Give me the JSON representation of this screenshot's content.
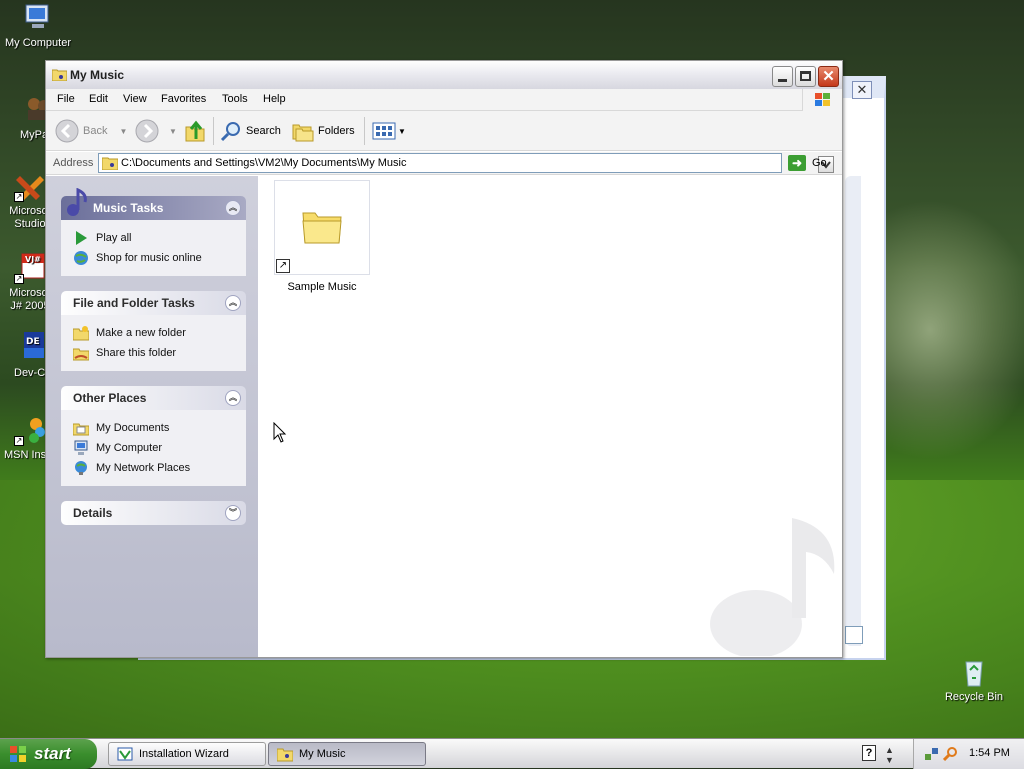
{
  "desktop": {
    "icons": [
      {
        "label": "My Computer"
      },
      {
        "label": "MyPa"
      },
      {
        "label": "Microsof Studio"
      },
      {
        "label": "Microsof J# 2005"
      },
      {
        "label": "Dev-C"
      },
      {
        "label": "MSN Ins"
      },
      {
        "label": "Recycle Bin"
      }
    ]
  },
  "window": {
    "title": "My Music",
    "menu": [
      "File",
      "Edit",
      "View",
      "Favorites",
      "Tools",
      "Help"
    ],
    "toolbar": {
      "back": "Back",
      "search": "Search",
      "folders": "Folders"
    },
    "address": {
      "label": "Address",
      "value": "C:\\Documents and Settings\\VM2\\My Documents\\My Music",
      "go": "Go"
    },
    "taskpane": {
      "music_tasks": {
        "title": "Music Tasks",
        "items": [
          "Play all",
          "Shop for music online"
        ]
      },
      "file_folder_tasks": {
        "title": "File and Folder Tasks",
        "items": [
          "Make a new folder",
          "Share this folder"
        ]
      },
      "other_places": {
        "title": "Other Places",
        "items": [
          "My Documents",
          "My Computer",
          "My Network Places"
        ]
      },
      "details": {
        "title": "Details"
      }
    },
    "files": [
      {
        "name": "Sample Music",
        "icon": "folder-shortcut-icon"
      }
    ]
  },
  "taskbar": {
    "start": "start",
    "buttons": [
      "Installation Wizard",
      "My Music"
    ],
    "clock": "1:54 PM"
  },
  "colors": {
    "taskpane_bg": "#b8bacb",
    "special_header": "#6b6f9a",
    "start_green": "#3a8e2d"
  }
}
